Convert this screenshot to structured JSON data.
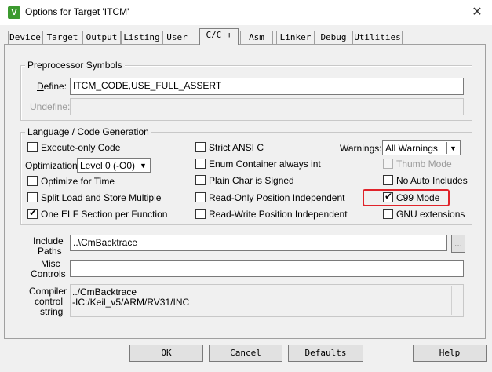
{
  "window": {
    "title": "Options for Target 'ITCM'",
    "icon_label": "V",
    "close_glyph": "✕"
  },
  "tabs": [
    "Device",
    "Target",
    "Output",
    "Listing",
    "User",
    "C/C++",
    "Asm",
    "Linker",
    "Debug",
    "Utilities"
  ],
  "active_tab": "C/C++",
  "preprocessor": {
    "group_title": "Preprocessor Symbols",
    "define_label": "Define:",
    "define_value": "ITCM_CODE,USE_FULL_ASSERT",
    "undefine_label": "Undefine:",
    "undefine_value": ""
  },
  "language": {
    "group_title": "Language / Code Generation",
    "execute_only_code": {
      "label": "Execute-only Code",
      "checked": false
    },
    "optimization_label": "Optimization:",
    "optimization_value": "Level 0 (-O0)",
    "optimize_for_time": {
      "label": "Optimize for Time",
      "checked": false
    },
    "split_load_store": {
      "label": "Split Load and Store Multiple",
      "checked": false
    },
    "one_elf_section": {
      "label": "One ELF Section per Function",
      "checked": true
    },
    "strict_ansi_c": {
      "label": "Strict ANSI C",
      "checked": false
    },
    "enum_container": {
      "label": "Enum Container always int",
      "checked": false
    },
    "plain_char_signed": {
      "label": "Plain Char is Signed",
      "checked": false
    },
    "ropi": {
      "label": "Read-Only Position Independent",
      "checked": false
    },
    "rwpi": {
      "label": "Read-Write Position Independent",
      "checked": false
    },
    "warnings_label": "Warnings:",
    "warnings_value": "All Warnings",
    "thumb_mode": {
      "label": "Thumb Mode",
      "checked": false
    },
    "no_auto_includes": {
      "label": "No Auto Includes",
      "checked": false
    },
    "c99_mode": {
      "label": "C99 Mode",
      "checked": true
    },
    "gnu_extensions": {
      "label": "GNU extensions",
      "checked": false
    },
    "check_glyph": "✔",
    "dropdown_glyph": "▼"
  },
  "include_paths": {
    "label_line1": "Include",
    "label_line2": "Paths",
    "value": "..\\CmBacktrace",
    "browse_label": "..."
  },
  "misc_controls": {
    "label_line1": "Misc",
    "label_line2": "Controls",
    "value": ""
  },
  "compiler_control": {
    "label_line1": "Compiler",
    "label_line2": "control",
    "label_line3": "string",
    "line1": "../CmBacktrace",
    "line2": "-IC:/Keil_v5/ARM/RV31/INC"
  },
  "buttons": {
    "ok": "OK",
    "cancel": "Cancel",
    "defaults": "Defaults",
    "help": "Help"
  }
}
